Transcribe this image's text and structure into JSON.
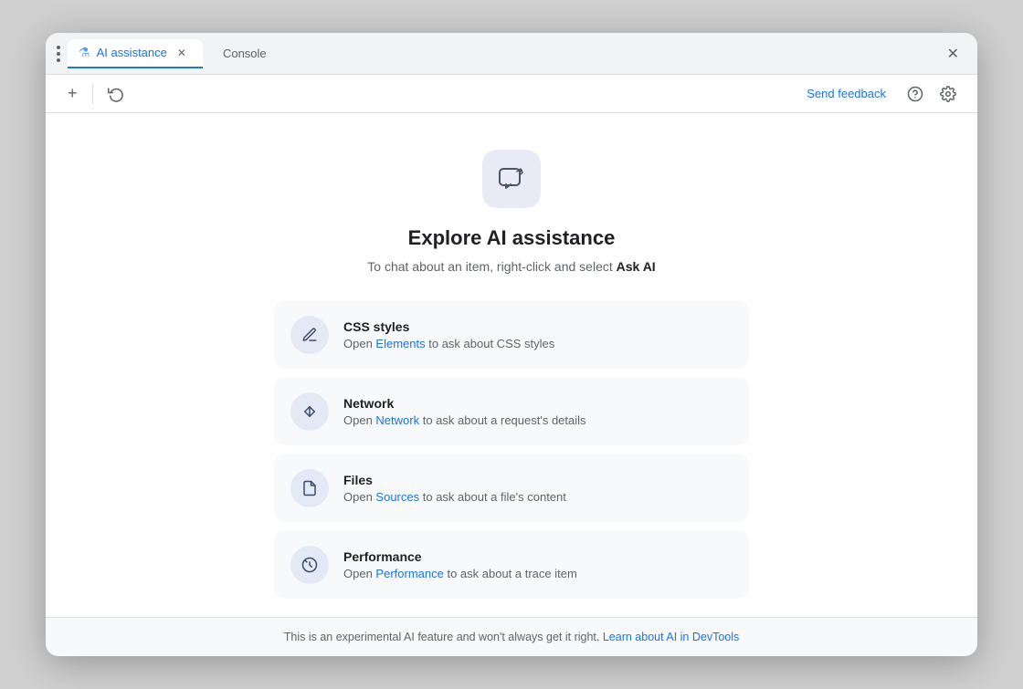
{
  "window": {
    "title": "AI assistance"
  },
  "titleBar": {
    "tabs": [
      {
        "id": "ai-assistance",
        "label": "AI assistance",
        "active": true,
        "hasClose": true,
        "iconSymbol": "⚗"
      },
      {
        "id": "console",
        "label": "Console",
        "active": false,
        "hasClose": false
      }
    ],
    "closeLabel": "✕"
  },
  "toolbar": {
    "addLabel": "+",
    "historyLabel": "↺",
    "sendFeedbackLabel": "Send feedback",
    "helpLabel": "?",
    "settingsLabel": "⚙"
  },
  "content": {
    "iconAlt": "AI chat icon",
    "title": "Explore AI assistance",
    "subtitle": "To chat about an item, right-click and select",
    "subtitleBold": "Ask AI",
    "features": [
      {
        "id": "css-styles",
        "title": "CSS styles",
        "descBefore": "Open ",
        "linkText": "Elements",
        "descAfter": " to ask about CSS styles",
        "iconSymbol": "✏"
      },
      {
        "id": "network",
        "title": "Network",
        "descBefore": "Open ",
        "linkText": "Network",
        "descAfter": " to ask about a request's details",
        "iconSymbol": "⇅"
      },
      {
        "id": "files",
        "title": "Files",
        "descBefore": "Open ",
        "linkText": "Sources",
        "descAfter": " to ask about a file's content",
        "iconSymbol": "▭"
      },
      {
        "id": "performance",
        "title": "Performance",
        "descBefore": "Open ",
        "linkText": "Performance",
        "descAfter": " to ask about a trace item",
        "iconSymbol": "◎"
      }
    ]
  },
  "footer": {
    "text": "This is an experimental AI feature and won't always get it right.",
    "linkText": "Learn about AI in DevTools",
    "linkHref": "#"
  },
  "colors": {
    "accent": "#1a73e8",
    "tabActive": "#1a73e8"
  }
}
